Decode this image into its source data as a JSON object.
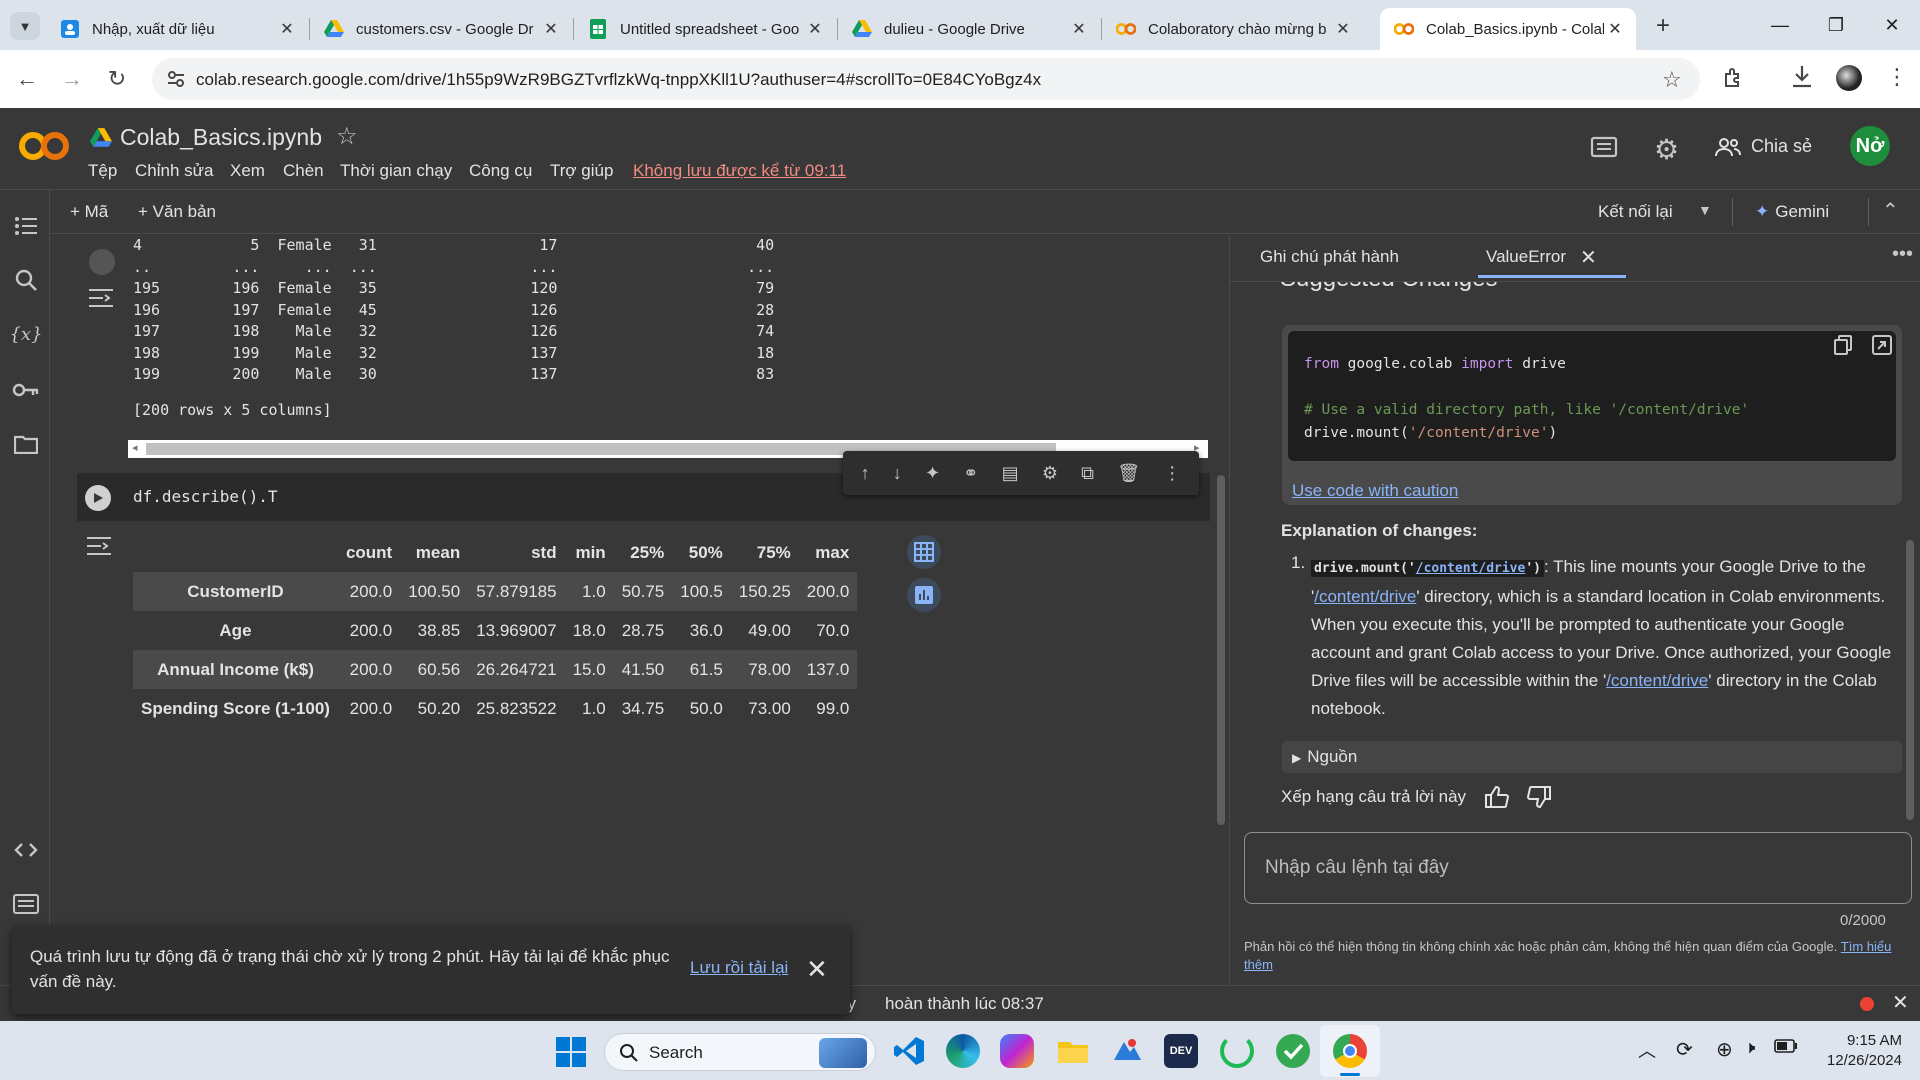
{
  "browser": {
    "tabs": [
      {
        "title": "Nhập, xuất dữ liệu",
        "icon": "classroom-icon",
        "active": false
      },
      {
        "title": "customers.csv - Google Dr",
        "icon": "drive-icon",
        "active": false
      },
      {
        "title": "Untitled spreadsheet - Goo",
        "icon": "sheets-icon",
        "active": false
      },
      {
        "title": "dulieu - Google Drive",
        "icon": "drive-icon",
        "active": false
      },
      {
        "title": "Colaboratory chào mừng b",
        "icon": "colab-icon",
        "active": false
      },
      {
        "title": "Colab_Basics.ipynb - Colab",
        "icon": "colab-icon",
        "active": true
      }
    ],
    "url": "colab.research.google.com/drive/1h55p9WzR9BGZTvrflzkWq-tnppXKll1U?authuser=4#scrollTo=0E84CYoBgz4x"
  },
  "colab": {
    "notebook_title": "Colab_Basics.ipynb",
    "menu": [
      "Tệp",
      "Chỉnh sửa",
      "Xem",
      "Chèn",
      "Thời gian chạy",
      "Công cụ",
      "Trợ giúp"
    ],
    "unsaved_notice": "Không lưu được kể từ 09:11",
    "share_label": "Chia sẻ",
    "avatar_initials": "Nở",
    "add_code": "+ Mã",
    "add_text": "+ Văn bản",
    "reconnect": "Kết nối lại",
    "gemini": "Gemini"
  },
  "prev_output": {
    "lines": [
      "4            5  Female   31                  17                      40",
      "..         ...     ...  ...                 ...                     ...",
      "195        196  Female   35                 120                      79",
      "196        197  Female   45                 126                      28",
      "197        198    Male   32                 126                      74",
      "198        199    Male   32                 137                      18",
      "199        200    Male   30                 137                      83"
    ],
    "summary": "[200 rows x 5 columns]"
  },
  "cell": {
    "code": "df.describe().T",
    "table": {
      "columns": [
        "",
        "count",
        "mean",
        "std",
        "min",
        "25%",
        "50%",
        "75%",
        "max"
      ],
      "rows": [
        [
          "CustomerID",
          "200.0",
          "100.50",
          "57.879185",
          "1.0",
          "50.75",
          "100.5",
          "150.25",
          "200.0"
        ],
        [
          "Age",
          "200.0",
          "38.85",
          "13.969007",
          "18.0",
          "28.75",
          "36.0",
          "49.00",
          "70.0"
        ],
        [
          "Annual Income (k$)",
          "200.0",
          "60.56",
          "26.264721",
          "15.0",
          "41.50",
          "61.5",
          "78.00",
          "137.0"
        ],
        [
          "Spending Score (1-100)",
          "200.0",
          "50.20",
          "25.823522",
          "1.0",
          "34.75",
          "50.0",
          "73.00",
          "99.0"
        ]
      ]
    }
  },
  "panel": {
    "tabs": [
      "Ghi chú phát hành",
      "ValueError"
    ],
    "heading": "Suggested Changes",
    "code_lines": {
      "l1_kw1": "from",
      "l1_mod": " google.colab ",
      "l1_kw2": "import",
      "l1_rest": " drive",
      "l3": "# Use a valid directory path, like '/content/drive'",
      "l4_a": "drive.mount(",
      "l4_str": "'/content/drive'",
      "l4_b": ")"
    },
    "caution_link": "Use code with caution",
    "explanation_heading": "Explanation of changes:",
    "explanation": {
      "number": "1.",
      "code_a": "drive.mount('",
      "code_link": "/content/drive",
      "code_b": "')",
      "t1": ": This line mounts your Google Drive to the '",
      "link1": "/content/drive",
      "t2": "' directory, which is a standard location in Colab environments. When you execute this, you'll be prompted to authenticate your Google account and grant Colab access to your Drive. Once authorized, your Google Drive files will be accessible within the '",
      "link2": "/content/drive",
      "t3": "' directory in the Colab notebook."
    },
    "sources": "Nguồn",
    "rate_label": "Xếp hạng câu trả lời này",
    "prompt_placeholder": "Nhập câu lệnh tại đây",
    "counter": "0/2000",
    "disclaimer": "Phản hồi có thể hiện thông tin không chính xác hoặc phản cảm, không thể hiện quan điểm của Google.",
    "learn_more": "Tìm hiểu thêm"
  },
  "toast": {
    "message": "Quá trình lưu tự động đã ở trạng thái chờ xử lý trong 2 phút. Hãy tải lại để khắc phục vấn đề này.",
    "action": "Lưu rồi tải lại"
  },
  "status": {
    "prefix": "ây",
    "text": "hoàn thành lúc 08:37"
  },
  "taskbar": {
    "search": "Search",
    "time": "9:15 AM",
    "date": "12/26/2024"
  }
}
